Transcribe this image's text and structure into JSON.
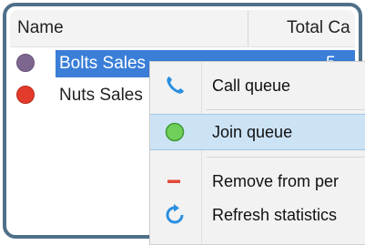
{
  "table": {
    "headers": {
      "name": "Name",
      "total": "Total Ca"
    },
    "rows": [
      {
        "name": "Bolts Sales",
        "total": "5",
        "status_color": "#7e678f",
        "selected": true
      },
      {
        "name": "Nuts Sales",
        "total": "",
        "status_color": "#e23a2b",
        "selected": false
      }
    ]
  },
  "context_menu": {
    "items": [
      {
        "label": "Call queue",
        "icon": "phone-icon",
        "icon_color": "#2a8fe0"
      },
      {
        "label": "Join queue",
        "icon": "green-circle-icon",
        "icon_color": "#5cbf4a",
        "highlighted": true
      },
      {
        "label": "Remove from per",
        "icon": "minus-icon",
        "icon_color": "#e24a3a"
      },
      {
        "label": "Refresh statistics",
        "icon": "refresh-icon",
        "icon_color": "#2a8fe0"
      }
    ]
  },
  "colors": {
    "frame_border": "#4f7089",
    "selection": "#3a7ed8",
    "menu_highlight": "#cce3f6"
  }
}
